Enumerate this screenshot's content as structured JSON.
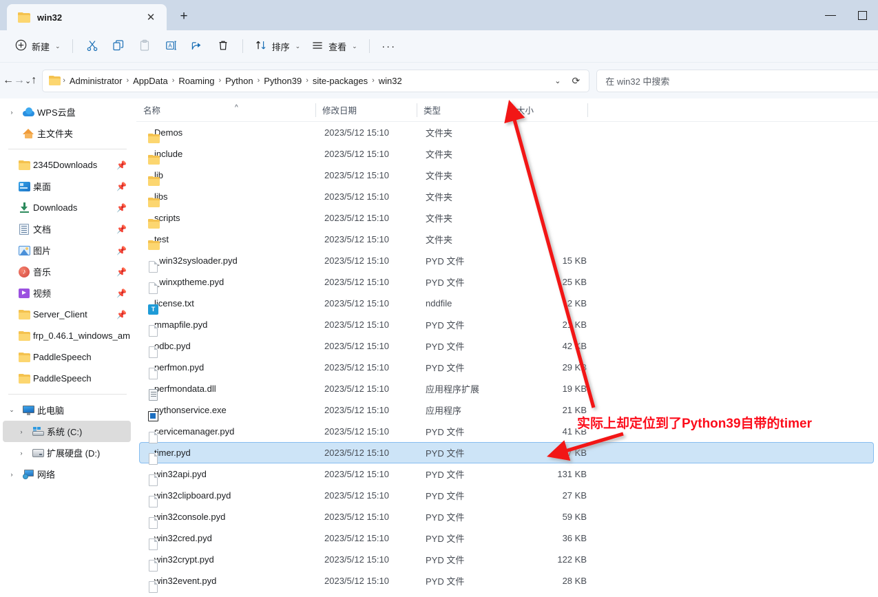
{
  "window": {
    "tab": {
      "title": "win32",
      "folder_icon": "folder-icon",
      "close_icon": "close-icon"
    },
    "new_tab_icon": "plus-icon",
    "controls": {
      "minimize": "minimize-icon",
      "maximize": "maximize-icon"
    }
  },
  "toolbar": {
    "new_label": "新建",
    "new_icon": "plus-circle-icon",
    "cut_icon": "scissors-icon",
    "copy_icon": "copy-icon",
    "paste_icon": "paste-icon",
    "rename_icon": "rename-icon",
    "share_icon": "share-icon",
    "delete_icon": "trash-icon",
    "sort_label": "排序",
    "sort_icon": "sort-arrows-icon",
    "view_label": "查看",
    "view_icon": "list-lines-icon",
    "more_label": "···",
    "chevron": "⌄"
  },
  "address": {
    "back_icon": "arrow-left-icon",
    "forward_icon": "arrow-right-icon",
    "recent_icon": "chevron-down-icon",
    "up_icon": "arrow-up-icon",
    "folder_icon": "folder-icon",
    "crumbs": [
      "Administrator",
      "AppData",
      "Roaming",
      "Python",
      "Python39",
      "site-packages",
      "win32"
    ],
    "separator": "›",
    "dropdown_icon": "chevron-down-icon",
    "refresh_icon": "refresh-icon",
    "search_placeholder": "在 win32 中搜索"
  },
  "sidebar": {
    "groups": [
      {
        "items": [
          {
            "label": "WPS云盘",
            "icon": "cloud-icon",
            "expander": "›",
            "pinned": false,
            "selected": false,
            "indent": false
          },
          {
            "label": "主文件夹",
            "icon": "home-icon",
            "expander": "",
            "pinned": false,
            "selected": false,
            "indent": false
          }
        ]
      },
      {
        "items": [
          {
            "label": "2345Downloads",
            "icon": "folder-icon",
            "expander": "",
            "pinned": true,
            "selected": false,
            "indent": true
          },
          {
            "label": "桌面",
            "icon": "desktop-icon",
            "expander": "",
            "pinned": true,
            "selected": false,
            "indent": true
          },
          {
            "label": "Downloads",
            "icon": "download-icon",
            "expander": "",
            "pinned": true,
            "selected": false,
            "indent": true
          },
          {
            "label": "文档",
            "icon": "document-icon",
            "expander": "",
            "pinned": true,
            "selected": false,
            "indent": true
          },
          {
            "label": "图片",
            "icon": "pictures-icon",
            "expander": "",
            "pinned": true,
            "selected": false,
            "indent": true
          },
          {
            "label": "音乐",
            "icon": "music-icon",
            "expander": "",
            "pinned": true,
            "selected": false,
            "indent": true
          },
          {
            "label": "视频",
            "icon": "video-icon",
            "expander": "",
            "pinned": true,
            "selected": false,
            "indent": true
          },
          {
            "label": "Server_Client",
            "icon": "folder-icon",
            "expander": "",
            "pinned": true,
            "selected": false,
            "indent": true
          },
          {
            "label": "frp_0.46.1_windows_am",
            "icon": "folder-icon",
            "expander": "",
            "pinned": false,
            "selected": false,
            "indent": true
          },
          {
            "label": "PaddleSpeech",
            "icon": "folder-icon",
            "expander": "",
            "pinned": false,
            "selected": false,
            "indent": true
          },
          {
            "label": "PaddleSpeech",
            "icon": "folder-icon",
            "expander": "",
            "pinned": false,
            "selected": false,
            "indent": true
          }
        ]
      },
      {
        "items": [
          {
            "label": "此电脑",
            "icon": "this-pc-icon",
            "expander": "⌄",
            "pinned": false,
            "selected": false,
            "indent": false
          },
          {
            "label": "系统 (C:)",
            "icon": "system-drive-icon",
            "expander": "›",
            "pinned": false,
            "selected": true,
            "indent": true
          },
          {
            "label": "扩展硬盘 (D:)",
            "icon": "drive-icon",
            "expander": "›",
            "pinned": false,
            "selected": false,
            "indent": true
          },
          {
            "label": "网络",
            "icon": "network-icon",
            "expander": "›",
            "pinned": false,
            "selected": false,
            "indent": false
          }
        ]
      }
    ]
  },
  "filelist": {
    "columns": {
      "name": "名称",
      "date": "修改日期",
      "type": "类型",
      "size": "大小"
    },
    "sort_indicator": "^",
    "rows": [
      {
        "name": "Demos",
        "date": "2023/5/12 15:10",
        "type": "文件夹",
        "size": "",
        "icon": "folder-icon",
        "selected": false
      },
      {
        "name": "include",
        "date": "2023/5/12 15:10",
        "type": "文件夹",
        "size": "",
        "icon": "folder-icon",
        "selected": false
      },
      {
        "name": "lib",
        "date": "2023/5/12 15:10",
        "type": "文件夹",
        "size": "",
        "icon": "folder-icon",
        "selected": false
      },
      {
        "name": "libs",
        "date": "2023/5/12 15:10",
        "type": "文件夹",
        "size": "",
        "icon": "folder-icon",
        "selected": false
      },
      {
        "name": "scripts",
        "date": "2023/5/12 15:10",
        "type": "文件夹",
        "size": "",
        "icon": "folder-icon",
        "selected": false
      },
      {
        "name": "test",
        "date": "2023/5/12 15:10",
        "type": "文件夹",
        "size": "",
        "icon": "folder-icon",
        "selected": false
      },
      {
        "name": "_win32sysloader.pyd",
        "date": "2023/5/12 15:10",
        "type": "PYD 文件",
        "size": "15 KB",
        "icon": "file-icon",
        "selected": false
      },
      {
        "name": "_winxptheme.pyd",
        "date": "2023/5/12 15:10",
        "type": "PYD 文件",
        "size": "25 KB",
        "icon": "file-icon",
        "selected": false
      },
      {
        "name": "license.txt",
        "date": "2023/5/12 15:10",
        "type": "nddfile",
        "size": "2 KB",
        "icon": "text-file-icon",
        "selected": false
      },
      {
        "name": "mmapfile.pyd",
        "date": "2023/5/12 15:10",
        "type": "PYD 文件",
        "size": "21 KB",
        "icon": "file-icon",
        "selected": false
      },
      {
        "name": "odbc.pyd",
        "date": "2023/5/12 15:10",
        "type": "PYD 文件",
        "size": "42 KB",
        "icon": "file-icon",
        "selected": false
      },
      {
        "name": "perfmon.pyd",
        "date": "2023/5/12 15:10",
        "type": "PYD 文件",
        "size": "29 KB",
        "icon": "file-icon",
        "selected": false
      },
      {
        "name": "perfmondata.dll",
        "date": "2023/5/12 15:10",
        "type": "应用程序扩展",
        "size": "19 KB",
        "icon": "dll-icon",
        "selected": false
      },
      {
        "name": "pythonservice.exe",
        "date": "2023/5/12 15:10",
        "type": "应用程序",
        "size": "21 KB",
        "icon": "exe-icon",
        "selected": false
      },
      {
        "name": "servicemanager.pyd",
        "date": "2023/5/12 15:10",
        "type": "PYD 文件",
        "size": "41 KB",
        "icon": "file-icon",
        "selected": false
      },
      {
        "name": "timer.pyd",
        "date": "2023/5/12 15:10",
        "type": "PYD 文件",
        "size": "17 KB",
        "icon": "file-icon",
        "selected": true
      },
      {
        "name": "win32api.pyd",
        "date": "2023/5/12 15:10",
        "type": "PYD 文件",
        "size": "131 KB",
        "icon": "file-icon",
        "selected": false
      },
      {
        "name": "win32clipboard.pyd",
        "date": "2023/5/12 15:10",
        "type": "PYD 文件",
        "size": "27 KB",
        "icon": "file-icon",
        "selected": false
      },
      {
        "name": "win32console.pyd",
        "date": "2023/5/12 15:10",
        "type": "PYD 文件",
        "size": "59 KB",
        "icon": "file-icon",
        "selected": false
      },
      {
        "name": "win32cred.pyd",
        "date": "2023/5/12 15:10",
        "type": "PYD 文件",
        "size": "36 KB",
        "icon": "file-icon",
        "selected": false
      },
      {
        "name": "win32crypt.pyd",
        "date": "2023/5/12 15:10",
        "type": "PYD 文件",
        "size": "122 KB",
        "icon": "file-icon",
        "selected": false
      },
      {
        "name": "win32event.pyd",
        "date": "2023/5/12 15:10",
        "type": "PYD 文件",
        "size": "28 KB",
        "icon": "file-icon",
        "selected": false
      }
    ]
  },
  "annotation": {
    "text": "实际上却定位到了Python39自带的timer",
    "color": "#fc0d1b"
  }
}
